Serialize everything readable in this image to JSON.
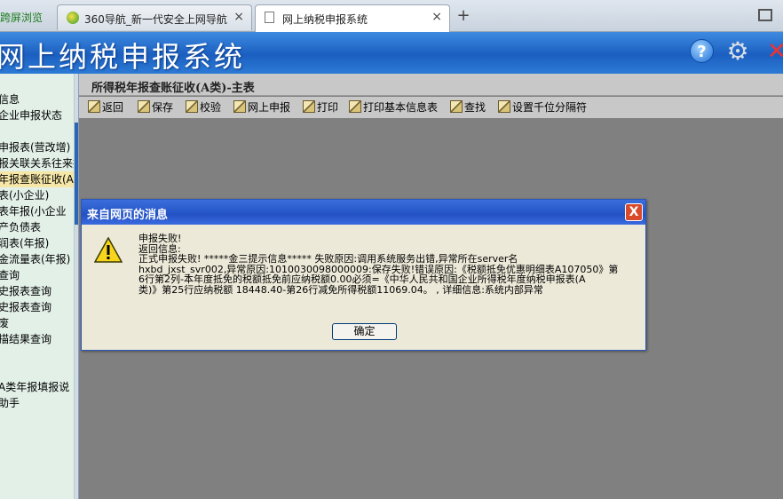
{
  "browser": {
    "tab0_label": "跨屏浏览",
    "tabs": [
      {
        "label": "360导航_新一代安全上网导航",
        "close": "×"
      },
      {
        "label": "网上纳税申报系统",
        "close": "×"
      }
    ],
    "new_tab": "+"
  },
  "banner": {
    "title": "网上纳税申报系统",
    "help_symbol": "?",
    "icons": [
      "help-icon",
      "gear-icon",
      "exit-icon"
    ]
  },
  "sidebar": {
    "items": [
      {
        "label": "信息",
        "active": false
      },
      {
        "label": "企业申报状态",
        "active": false
      },
      {
        "label": "",
        "active": false
      },
      {
        "label": "申报表(营改增)",
        "active": false
      },
      {
        "label": "报关联关系往来报",
        "active": false
      },
      {
        "label": "年报查账征收(A",
        "active": true
      },
      {
        "label": "表(小企业)",
        "active": false
      },
      {
        "label": "表年报(小企业",
        "active": false
      },
      {
        "label": "产负债表",
        "active": false
      },
      {
        "label": "润表(年报)",
        "active": false
      },
      {
        "label": "金流量表(年报)",
        "active": false
      },
      {
        "label": "查询",
        "active": false
      },
      {
        "label": "史报表查询",
        "active": false
      },
      {
        "label": "史报表查询",
        "active": false
      },
      {
        "label": "废",
        "active": false
      },
      {
        "label": "描结果查询",
        "active": false
      },
      {
        "label": "",
        "active": false
      },
      {
        "label": "",
        "active": false
      },
      {
        "label": "A类年报填报说",
        "active": false
      },
      {
        "label": "助手",
        "active": false
      }
    ]
  },
  "main": {
    "heading": "所得税年报查账征收(A类)-主表",
    "toolbar": [
      "返回",
      "保存",
      "校验",
      "网上申报",
      "打印",
      "打印基本信息表",
      "查找",
      "设置千位分隔符"
    ]
  },
  "dialog": {
    "title": "来自网页的消息",
    "close": "X",
    "lines": [
      "申报失败!",
      "返回信息:",
      "正式申报失败! *****金三提示信息***** 失败原因:调用系统服务出错,异常所在server名",
      "hxbd_jxst_svr002,异常原因:1010030098000009:保存失败!错误原因:《税额抵免优惠明细表A107050》第",
      "6行第2列-本年度抵免的税额抵免前应纳税额0.00必须=《中华人民共和国企业所得税年度纳税申报表(A",
      "类)》第25行应纳税额 18448.40-第26行减免所得税额11069.04。 , 详细信息:系统内部异常"
    ],
    "ok_label": "确定"
  }
}
